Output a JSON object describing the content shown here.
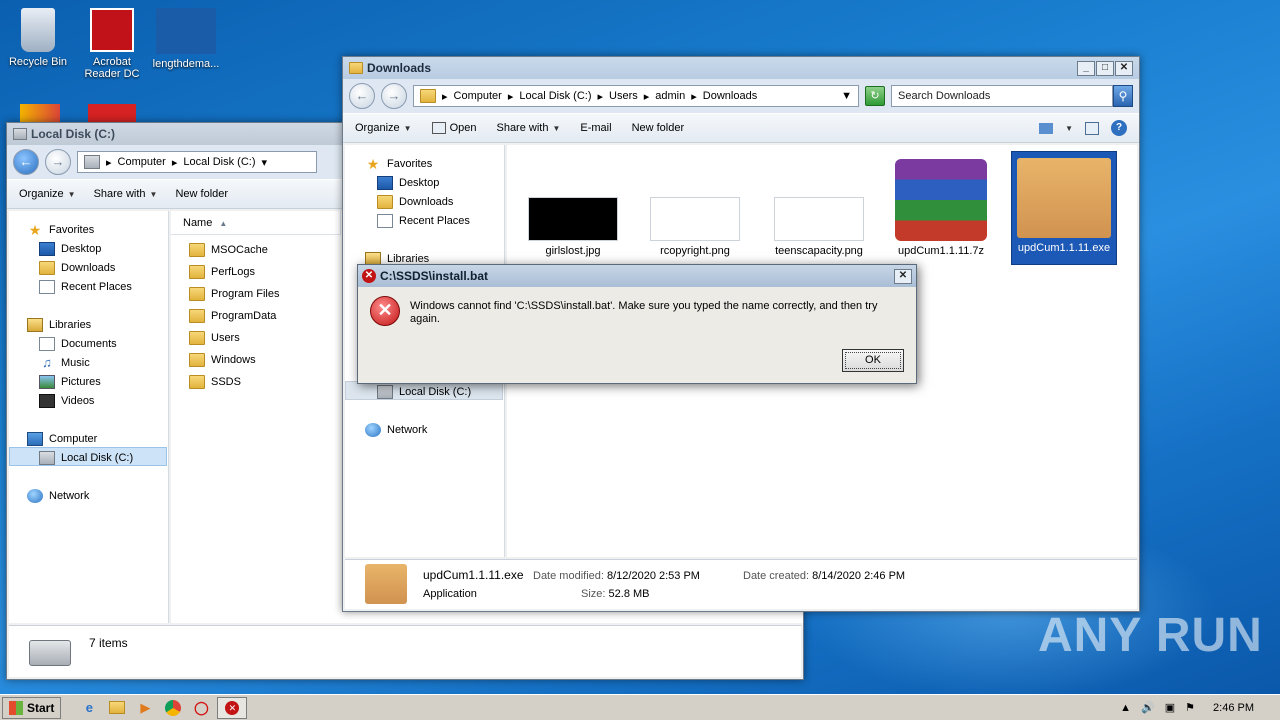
{
  "desktop": {
    "icons": [
      {
        "label": "Recycle Bin"
      },
      {
        "label": "Acrobat Reader DC"
      },
      {
        "label": "lengthdema..."
      }
    ]
  },
  "left_window": {
    "title": "Local Disk (C:)",
    "breadcrumb": [
      "Computer",
      "Local Disk (C:)"
    ],
    "toolbar": {
      "organize": "Organize",
      "share_with": "Share with",
      "new_folder": "New folder"
    },
    "nav": {
      "favorites": "Favorites",
      "desktop": "Desktop",
      "downloads": "Downloads",
      "recent": "Recent Places",
      "libraries": "Libraries",
      "documents": "Documents",
      "music": "Music",
      "pictures": "Pictures",
      "videos": "Videos",
      "computer": "Computer",
      "local_disk": "Local Disk (C:)",
      "network": "Network"
    },
    "column_header": "Name",
    "files": [
      "MSOCache",
      "PerfLogs",
      "Program Files",
      "ProgramData",
      "Users",
      "Windows",
      "SSDS"
    ],
    "status": "7 items"
  },
  "right_window": {
    "title": "Downloads",
    "breadcrumb": [
      "Computer",
      "Local Disk (C:)",
      "Users",
      "admin",
      "Downloads"
    ],
    "search_placeholder": "Search Downloads",
    "toolbar": {
      "organize": "Organize",
      "open": "Open",
      "share_with": "Share with",
      "email": "E-mail",
      "new_folder": "New folder"
    },
    "nav": {
      "favorites": "Favorites",
      "desktop": "Desktop",
      "downloads": "Downloads",
      "recent": "Recent Places",
      "libraries": "Libraries",
      "local_disk": "Local Disk (C:)",
      "network": "Network"
    },
    "thumbnails": [
      {
        "name": "girlslost.jpg"
      },
      {
        "name": "rcopyright.png"
      },
      {
        "name": "teenscapacity.png"
      },
      {
        "name": "updCum1.1.11.7z"
      },
      {
        "name": "updCum1.1.11.exe"
      }
    ],
    "details": {
      "filename": "updCum1.1.11.exe",
      "date_modified_label": "Date modified:",
      "date_modified": "8/12/2020 2:53 PM",
      "date_created_label": "Date created:",
      "date_created": "8/14/2020 2:46 PM",
      "type": "Application",
      "size_label": "Size:",
      "size": "52.8 MB"
    }
  },
  "dialog": {
    "title": "C:\\SSDS\\install.bat",
    "message": "Windows cannot find 'C:\\SSDS\\install.bat'. Make sure you typed the name correctly, and then try again.",
    "ok_label": "OK"
  },
  "taskbar": {
    "start_label": "Start",
    "clock": "2:46 PM"
  },
  "watermark": "ANY RUN"
}
